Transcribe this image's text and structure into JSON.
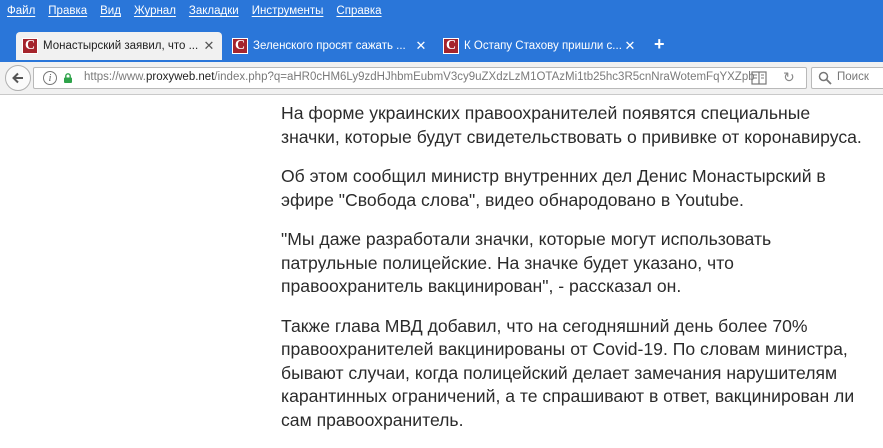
{
  "browser": {
    "menu": [
      "Файл",
      "Правка",
      "Вид",
      "Журнал",
      "Закладки",
      "Инструменты",
      "Справка"
    ],
    "tabs": [
      {
        "title": "Монастырский заявил, что ...",
        "close": "✕",
        "favicon_letter": "C",
        "active": true
      },
      {
        "title": "Зеленского просят сажать ...",
        "close": "✕",
        "favicon_letter": "C",
        "active": false
      },
      {
        "title": "К Остапу Стахову пришли с...",
        "close": "✕",
        "favicon_letter": "C",
        "active": false
      }
    ],
    "new_tab": "+",
    "url": {
      "prefix": "https://www.",
      "host": "proxyweb.net",
      "rest": "/index.php?q=aHR0cHM6Ly9zdHJhbmEubmV3cy9uZXdzLzM1OTAzMi1tb25hc3R5cnNraWotemFqYXZpbC1jaC1...."
    },
    "search_placeholder": "Поиск",
    "colors": {
      "chrome_blue": "#2a76d9",
      "favicon_red": "#a5242c"
    }
  },
  "article": {
    "paragraphs": [
      [
        "На форме украинских правоохранителей появятся специальные",
        "значки, которые будут свидетельствовать о прививке от коронавируса."
      ],
      [
        "Об этом сообщил министр внутренних дел Денис Монастырский в",
        "эфире \"Свобода слова\", видео обнародовано в Youtube."
      ],
      [
        "\"Мы даже разработали значки, которые могут использовать",
        "патрульные полицейские. На значке будет указано, что",
        "правоохранитель вакцинирован\", - рассказал он."
      ],
      [
        "Также глава МВД добавил, что на сегодняшний день более 70%",
        "правоохранителей вакцинированы от Covid-19. По словам министра,",
        "бывают случаи, когда полицейский делает замечания нарушителям",
        "карантинных ограничений, а те спрашивают в ответ, вакцинирован ли",
        "сам правоохранитель."
      ]
    ]
  }
}
